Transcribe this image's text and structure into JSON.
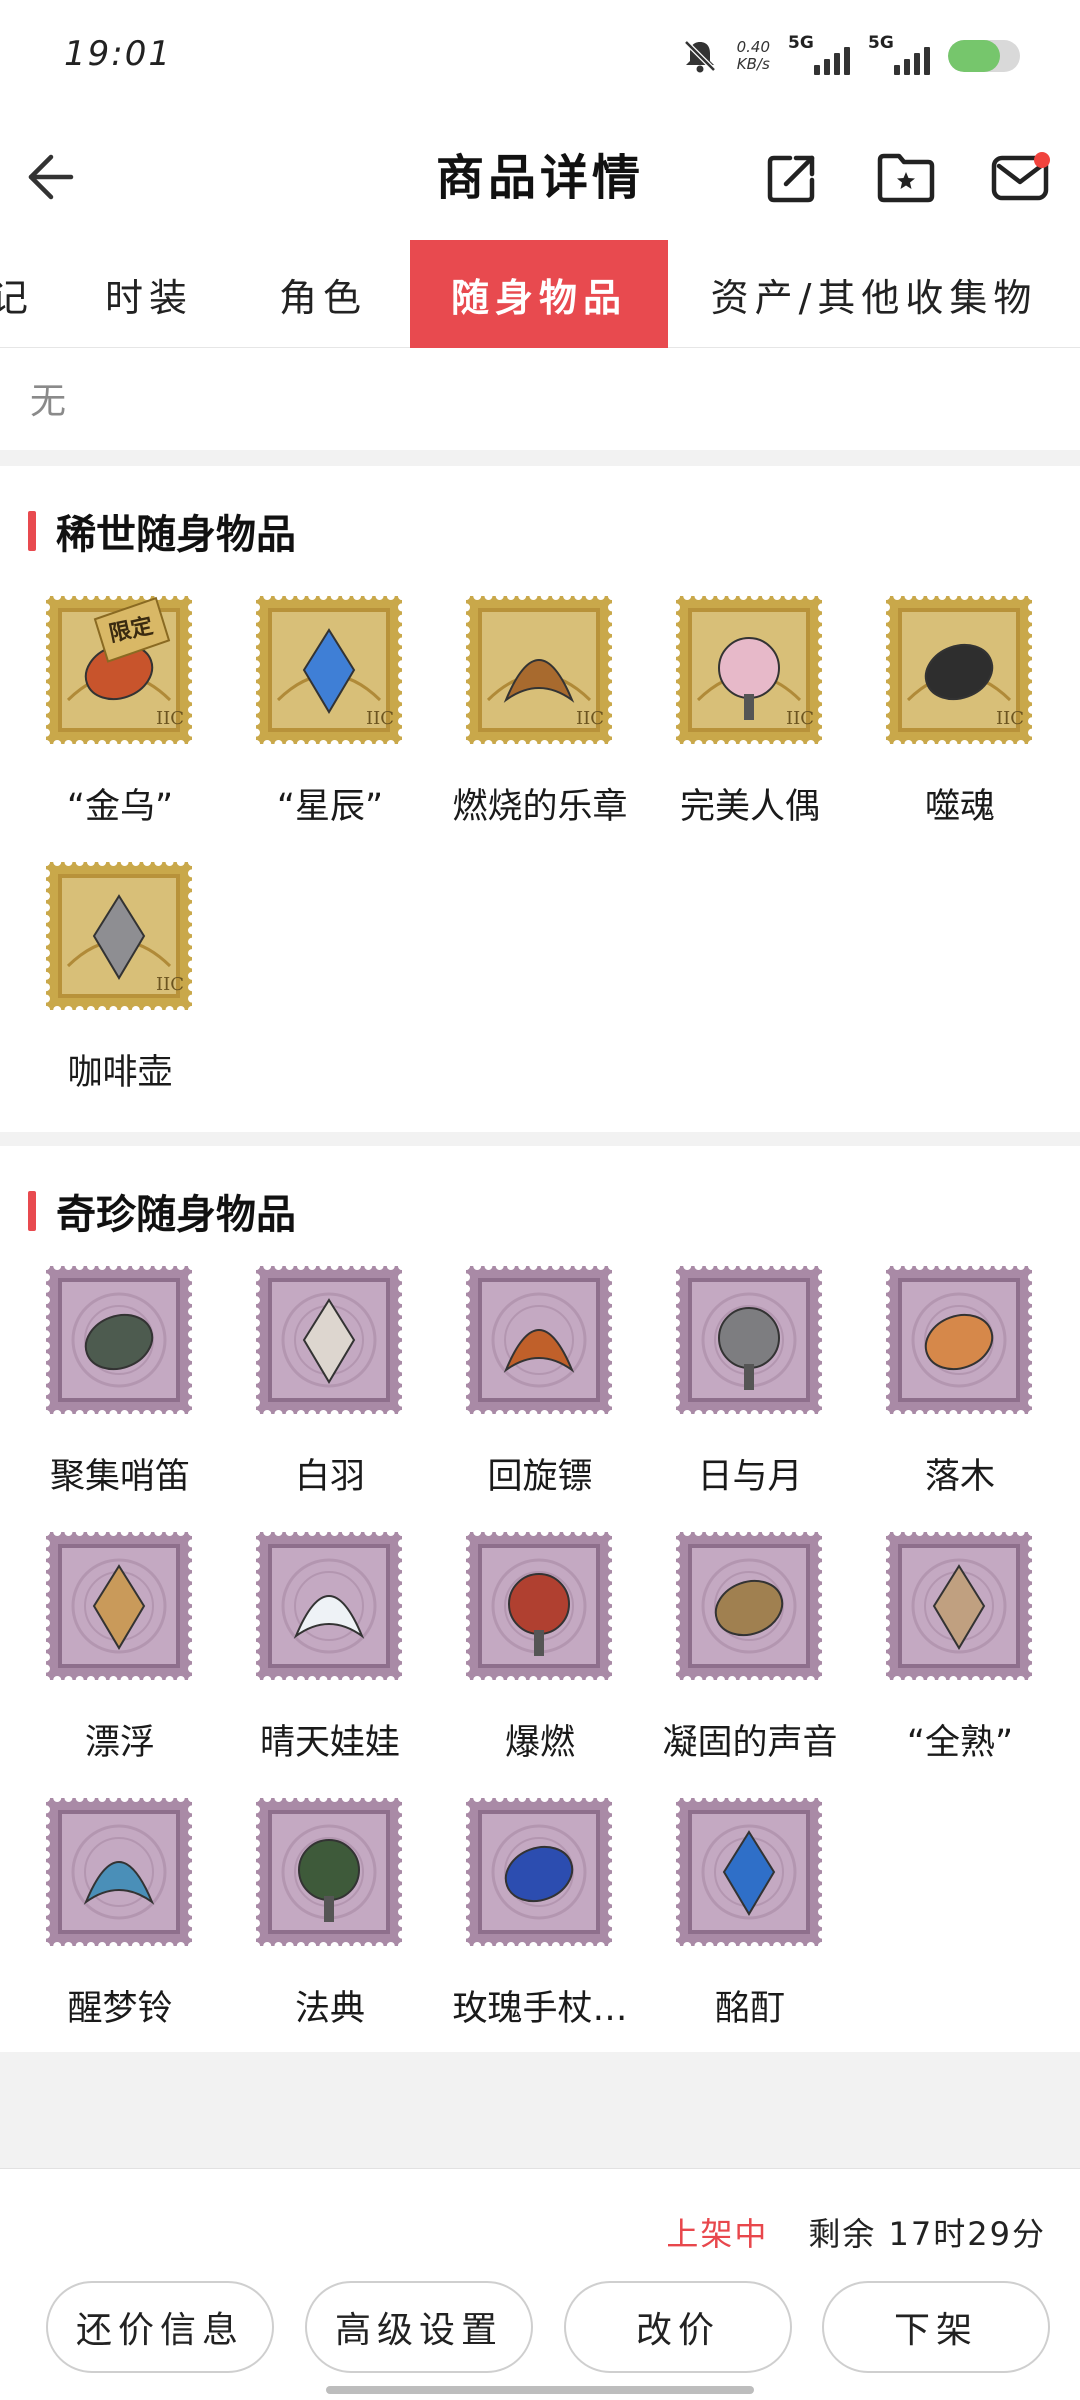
{
  "status": {
    "time": "19:01",
    "net_speed_value": "0.40",
    "net_speed_unit": "KB/s",
    "signal1": "5G",
    "signal2": "5G",
    "battery_level": 0.72
  },
  "header": {
    "title": "商品详情",
    "icons": [
      "back-arrow-icon",
      "share-icon",
      "favorite-folder-icon",
      "mail-icon"
    ]
  },
  "tabs": [
    {
      "label": "记",
      "active": false
    },
    {
      "label": "时装",
      "active": false
    },
    {
      "label": "角色",
      "active": false
    },
    {
      "label": "随身物品",
      "active": true
    },
    {
      "label": "资产/其他收集物",
      "active": false
    }
  ],
  "none_label": "无",
  "rare_section": {
    "title": "稀世随身物品",
    "limited_label": "限定",
    "items": [
      {
        "name": "“金乌”",
        "limited": true
      },
      {
        "name": "“星辰”"
      },
      {
        "name": "燃烧的乐章"
      },
      {
        "name": "完美人偶"
      },
      {
        "name": "噬魂"
      },
      {
        "name": "咖啡壶"
      }
    ]
  },
  "treasure_section": {
    "title": "奇珍随身物品",
    "items": [
      {
        "name": "聚集哨笛"
      },
      {
        "name": "白羽"
      },
      {
        "name": "回旋镖"
      },
      {
        "name": "日与月"
      },
      {
        "name": "落木"
      },
      {
        "name": "漂浮"
      },
      {
        "name": "晴天娃娃"
      },
      {
        "name": "爆燃"
      },
      {
        "name": "凝固的声音"
      },
      {
        "name": "“全熟”"
      },
      {
        "name": "醒梦铃"
      },
      {
        "name": "法典"
      },
      {
        "name": "玫瑰手杖…"
      },
      {
        "name": "酩酊"
      }
    ]
  },
  "bottom": {
    "status": "上架中",
    "remaining": "剩余 17时29分",
    "buttons": [
      "还价信息",
      "高级设置",
      "改价",
      "下架"
    ]
  },
  "colors": {
    "accent": "#e84a4f",
    "gold_stamp": "#c9a84a",
    "purple_stamp": "#a98aa6"
  }
}
